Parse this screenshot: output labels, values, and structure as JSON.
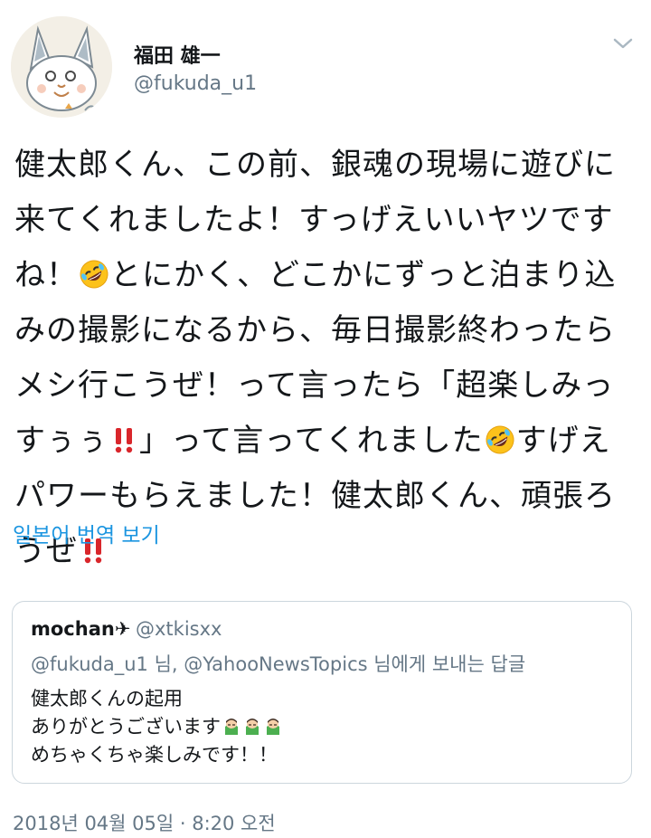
{
  "user": {
    "name": "福田 雄一",
    "handle": "@fukuda_u1"
  },
  "tweet": {
    "lines": [
      "健太郎くん、この前、銀魂の現場に遊びに",
      "来てくれましたよ！すっげえいいヤツです",
      [
        "ね！",
        "とにかく、どこかにずっと泊まり込"
      ],
      "みの撮影になるから、毎日撮影終わったら",
      "メシ行こうぜ！って言ったら「超楽しみっ",
      [
        "すぅぅ",
        "」って言ってくれました",
        "すげえ"
      ],
      "パワーもらえました！健太郎くん、頑張ろ",
      "うぜ"
    ]
  },
  "translate_link": "일본어 번역 보기",
  "quoted_tweet": {
    "name": "mochan",
    "name_suffix": "✈",
    "handle": "@xtkisxx",
    "reply_to": "@fukuda_u1 님, @YahooNewsTopics 님에게 보내는 답글",
    "lines": [
      "健太郎くんの起用",
      "ありがとうございます",
      "めちゃくちゃ楽しみです！！"
    ]
  },
  "timestamp": "2018년 04월 05일 · 8:20 오전",
  "colors": {
    "link_blue": "#1b95e0",
    "secondary_gray": "#657786",
    "border": "#ccd6dd",
    "bang_red": "#d9262b"
  },
  "icons": [
    "avatar-illustration",
    "chevron-down-icon",
    "rolling-laughing-emoji",
    "double-exclamation-emoji",
    "bowing-person-emoji"
  ]
}
